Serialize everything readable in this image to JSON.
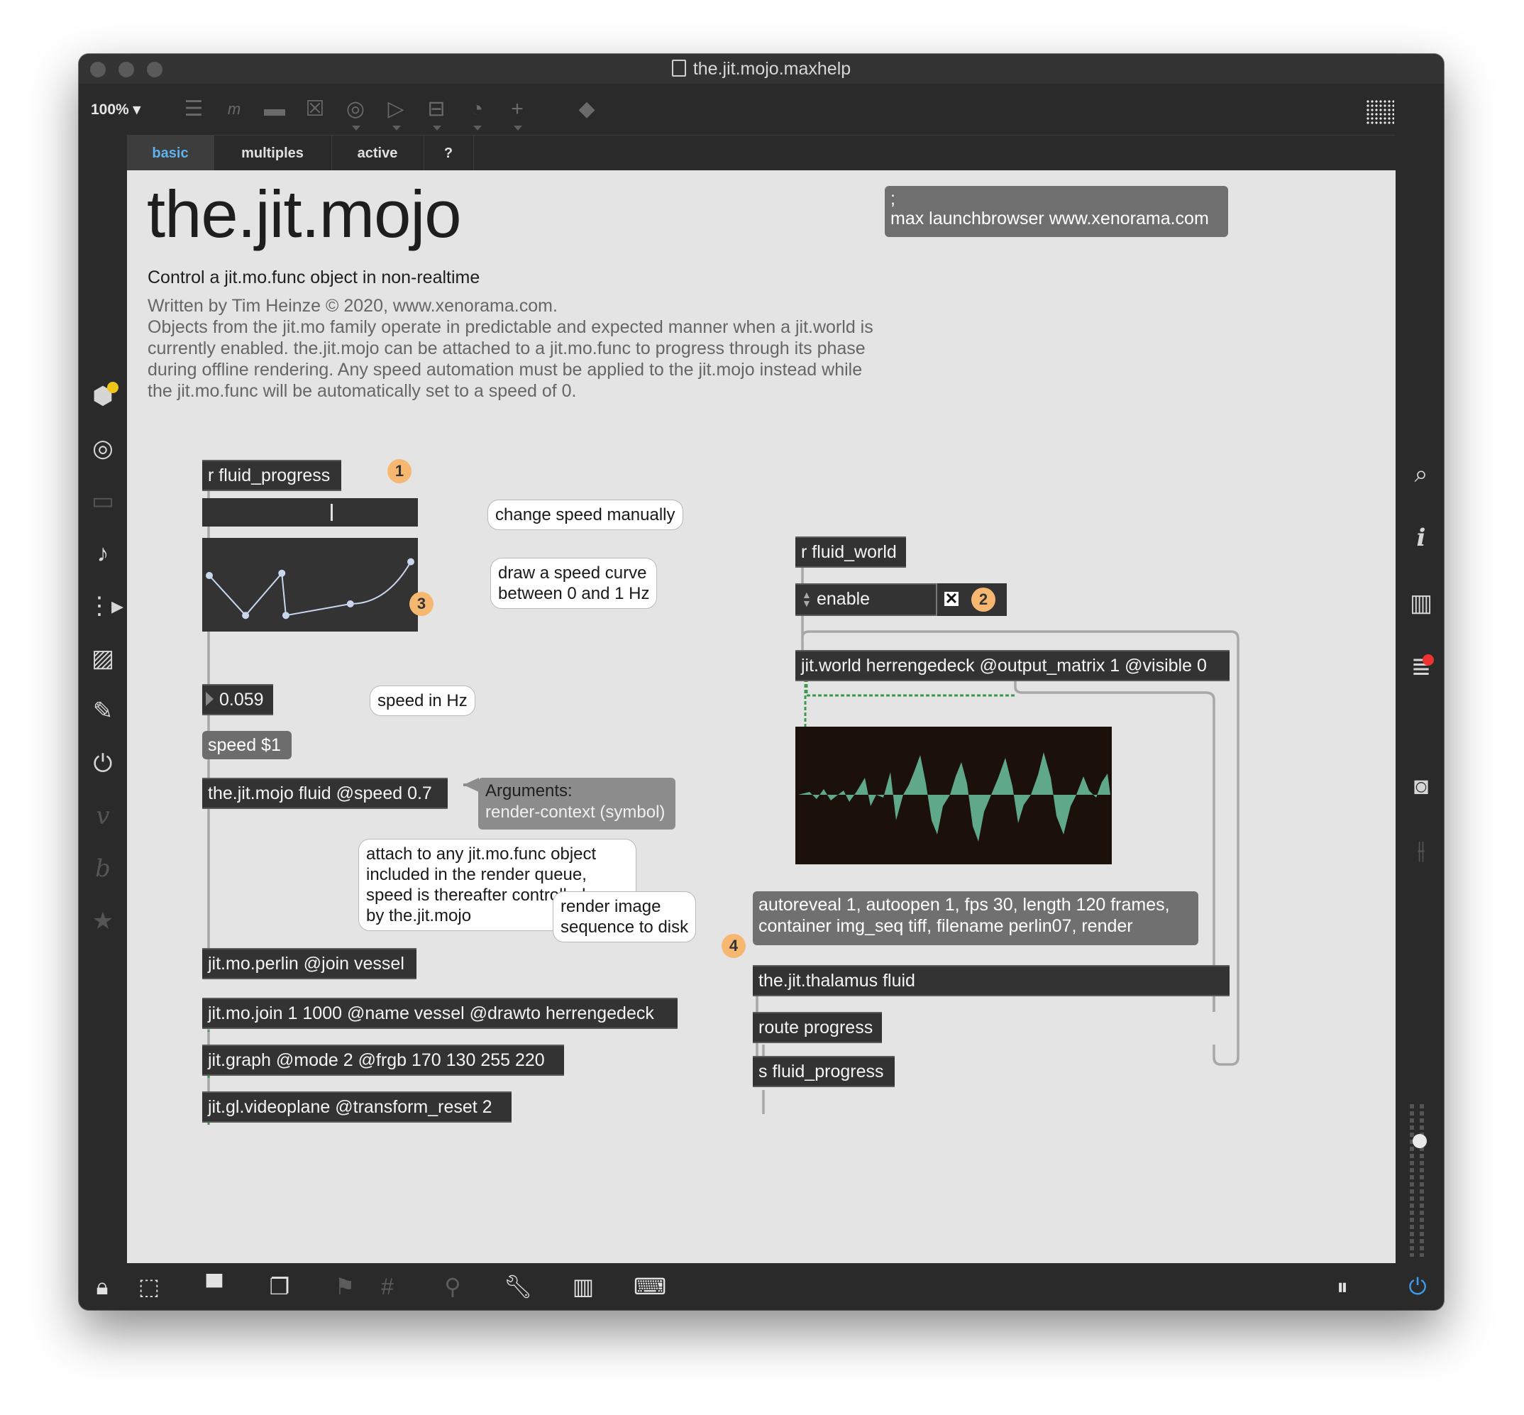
{
  "window": {
    "title": "the.jit.mojo.maxhelp"
  },
  "toolbar": {
    "zoom": "100%",
    "icons": [
      "object-box-icon",
      "message-box-icon",
      "comment-icon",
      "toggle-icon",
      "button-icon",
      "number-box-icon",
      "slider-icon",
      "dial-icon",
      "add-object-icon",
      "paint-bucket-icon",
      "grid-icon"
    ]
  },
  "tabs": [
    {
      "label": "basic",
      "active": true
    },
    {
      "label": "multiples",
      "active": false
    },
    {
      "label": "active",
      "active": false
    },
    {
      "label": "?",
      "active": false
    }
  ],
  "patch": {
    "title": "the.jit.mojo",
    "subtitle": "Control a jit.mo.func object in non-realtime",
    "description_lines": [
      "Written by Tim Heinze © 2020, www.xenorama.com.",
      "Objects from the jit.mo family operate in predictable and expected manner when a jit.world is",
      "currently enabled. the.jit.mojo can be attached to a jit.mo.func to progress through its phase",
      "during offline rendering. Any speed automation must be applied to the jit.mojo instead while",
      "the jit.mo.func will be automatically set to a speed of 0."
    ],
    "launch_msg": {
      "line1": ";",
      "line2": "max launchbrowser www.xenorama.com"
    },
    "left": {
      "r_fluid_progress": "r fluid_progress",
      "slider_value": 0.6,
      "comment_change_speed": "change speed manually",
      "comment_draw_curve": [
        "draw a speed curve",
        "between 0 and 1 Hz"
      ],
      "speed_number": "0.059",
      "comment_speed_hz": "speed in Hz",
      "speed_msg": "speed $1",
      "mojo_object": "the.jit.mojo fluid @speed 0.7",
      "arguments_label": "Arguments:",
      "arguments_value": "render-context (symbol)",
      "comment_attach": [
        "attach to any jit.mo.func object",
        "included in the render queue,",
        "speed is thereafter controlled",
        "by the.jit.mojo"
      ],
      "perlin": "jit.mo.perlin @join vessel",
      "join": "jit.mo.join 1 1000 @name vessel @drawto herrengedeck",
      "graph": "jit.graph @mode 2 @frgb 170 130 255 220",
      "videoplane": "jit.gl.videoplane @transform_reset 2"
    },
    "right": {
      "r_fluid_world": "r fluid_world",
      "enable_label": "enable",
      "toggle_checked": true,
      "world": "jit.world herrengedeck @output_matrix 1 @visible 0",
      "comment_render": [
        "render image",
        "sequence to disk"
      ],
      "render_msg": [
        "autoreveal 1, autoopen 1, fps 30, length 120 frames,",
        "container img_seq tiff, filename perlin07, render"
      ],
      "thalamus": "the.jit.thalamus fluid",
      "route": "route progress",
      "send": "s fluid_progress"
    },
    "badges": [
      "1",
      "2",
      "3",
      "4"
    ]
  },
  "function_curve": {
    "type": "line",
    "x": [
      0,
      0.18,
      0.36,
      0.38,
      0.7,
      1.0
    ],
    "y": [
      0.62,
      0.1,
      0.65,
      0.1,
      0.25,
      0.8
    ],
    "ylim": [
      0,
      1
    ]
  },
  "colors": {
    "accent_tab": "#5fb3ec",
    "badge": "#f6b770",
    "waveform": "#5fa98a",
    "comment_text": "#666666"
  },
  "sidebar_left": [
    "package-icon",
    "target-icon",
    "presentation-icon",
    "music-note-icon",
    "sequence-icon",
    "image-icon",
    "paperclip-icon",
    "plug-icon",
    "vizzie-icon",
    "beap-icon",
    "star-icon"
  ],
  "sidebar_right": [
    "search-icon",
    "info-icon",
    "reference-icon",
    "console-icon",
    "snapshot-icon",
    "mixer-icon"
  ],
  "bottom_bar": [
    "lock-icon",
    "edit-mode-icon",
    "presentation-mode-icon",
    "layers-icon",
    "align-icon",
    "grid-snap-icon",
    "patch-cord-icon",
    "wrench-icon",
    "piano-icon",
    "keyboard-icon",
    "audio-pause-icon",
    "audio-power-icon"
  ]
}
